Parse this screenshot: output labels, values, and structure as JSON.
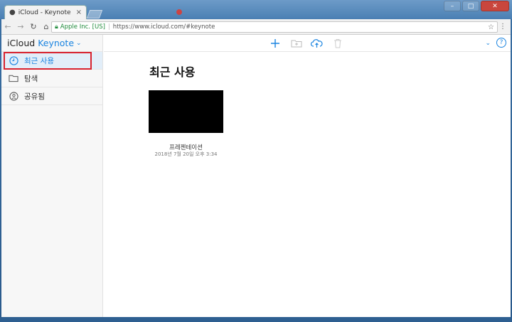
{
  "browser": {
    "tab_title": "iCloud - Keynote",
    "tab_close": "×",
    "ghost_tab_title": "",
    "security_label": "Apple Inc. [US]",
    "url": "https://www.icloud.com/#keynote",
    "window_buttons": [
      "–",
      "□",
      "✕"
    ]
  },
  "sidebar": {
    "brand": "iCloud",
    "app_name": "Keynote",
    "items": [
      {
        "label": "최근 사용",
        "icon": "clock-icon",
        "selected": true
      },
      {
        "label": "탐색",
        "icon": "folder-icon",
        "selected": false
      },
      {
        "label": "공유됨",
        "icon": "shared-person-icon",
        "selected": false
      }
    ]
  },
  "main": {
    "heading": "최근 사용",
    "document": {
      "name": "프레젠테이션",
      "date": "2018년 7월 20일 오후 3:34"
    },
    "help_label": "?"
  },
  "colors": {
    "accent": "#1a84e0",
    "highlight": "#d8232f"
  }
}
